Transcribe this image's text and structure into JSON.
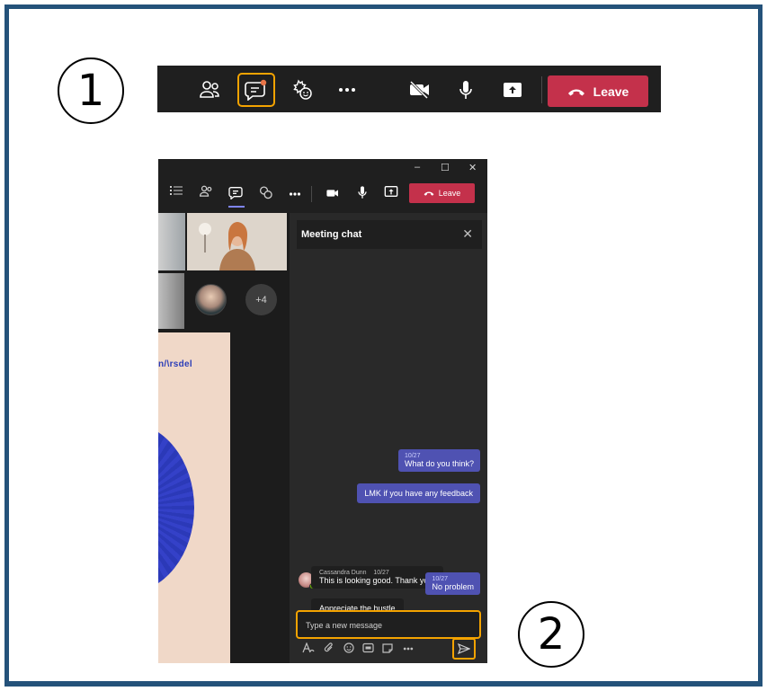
{
  "callouts": {
    "step1": "1",
    "step2": "2"
  },
  "toolbar": {
    "icons": [
      "people-icon",
      "chat-icon",
      "reactions-icon",
      "more-icon",
      "camera-off-icon",
      "mic-icon",
      "share-icon"
    ],
    "leave_label": "Leave",
    "colors": {
      "bar": "#1f1f1f",
      "leave": "#c4314b",
      "highlight": "#f4a300",
      "notification": "#e97548"
    }
  },
  "window": {
    "controls": {
      "minimize": "–",
      "maximize": "☐",
      "close": "✕"
    },
    "toolbar": {
      "icons": [
        "list-icon",
        "people-icon",
        "chat-icon",
        "reactions-icon",
        "more-icon",
        "video-icon",
        "mic-icon",
        "share-icon"
      ],
      "leave_label": "Leave"
    },
    "gallery": {
      "more_participants": "+4"
    },
    "slide": {
      "logo_text": "n/\\rsdel"
    },
    "chat": {
      "title": "Meeting chat",
      "close": "✕",
      "messages": [
        {
          "direction": "out",
          "date": "10/27",
          "text": "What do you think?"
        },
        {
          "direction": "out",
          "date": "",
          "text": "LMK if you have any feedback"
        },
        {
          "direction": "in",
          "sender": "Cassandra Dunn",
          "date": "10/27",
          "text": "This is looking good. Thank you!"
        },
        {
          "direction": "in",
          "sender": "",
          "date": "",
          "text": "Appreciate the hustle"
        },
        {
          "direction": "out",
          "date": "10/27",
          "text": "No problem"
        }
      ],
      "compose_placeholder": "Type a new message",
      "compose_tools": [
        "format-icon",
        "attach-icon",
        "emoji-icon",
        "gif-icon",
        "sticker-icon",
        "more-icon"
      ],
      "accent": "#4f52b2"
    }
  }
}
